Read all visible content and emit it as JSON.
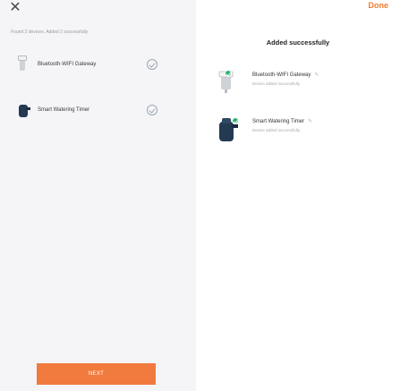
{
  "background_screen": {
    "close_icon": "close-icon",
    "found_text": "Found 2 devices. Added 2 successfully.",
    "devices": [
      {
        "label": "Bluetooth-WIFI Gateway",
        "icon": "gateway-icon"
      },
      {
        "label": "Smart Watering Timer",
        "icon": "watering-timer-icon"
      }
    ],
    "next_label": "NEXT"
  },
  "dialog": {
    "done_label": "Done",
    "title": "Added successfully",
    "devices": [
      {
        "name": "Bluetooth-WIFI Gateway",
        "status": "Device added successfully"
      },
      {
        "name": "Smart Watering Timer",
        "status": "Device added successfully"
      }
    ]
  },
  "colors": {
    "accent": "#f07a2e",
    "success": "#2db36a",
    "next_button": "#f17a3e"
  }
}
